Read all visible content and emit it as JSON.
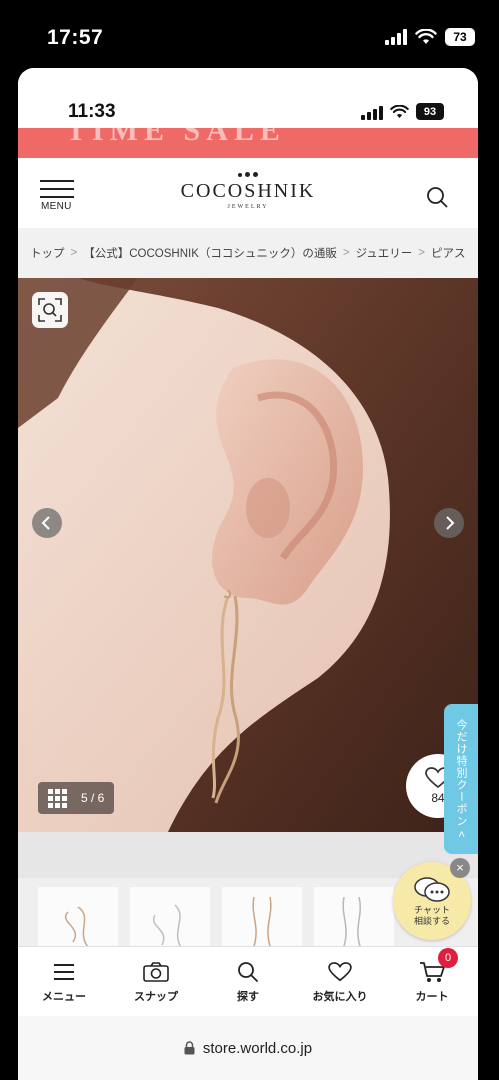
{
  "outer_status": {
    "time": "17:57",
    "battery": "73"
  },
  "inner_status": {
    "time": "11:33",
    "battery": "93"
  },
  "banner": {
    "text": "TIME SALE"
  },
  "header": {
    "menu_label": "MENU",
    "logo": "COCOSHNIK",
    "logo_sub": "JEWELRY"
  },
  "breadcrumb": [
    "トップ",
    "【公式】COCOSHNIK（ココシュニック）の通販",
    "ジュエリー",
    "ピアス"
  ],
  "gallery": {
    "page_indicator": "5 / 6",
    "favorite_count": "84"
  },
  "coupon_tab": "今だけ特別クーポン <",
  "chat": {
    "line1": "チャット",
    "line2": "相談する",
    "close": "×"
  },
  "bottom_nav": [
    {
      "label": "メニュー",
      "icon": "hamburger-icon"
    },
    {
      "label": "スナップ",
      "icon": "camera-icon"
    },
    {
      "label": "探す",
      "icon": "search-icon"
    },
    {
      "label": "お気に入り",
      "icon": "heart-icon"
    },
    {
      "label": "カート",
      "icon": "cart-icon",
      "badge": "0"
    }
  ],
  "url": "store.world.co.jp",
  "colors": {
    "sale_banner": "#ef6a66",
    "coupon": "#6fc8e4",
    "badge": "#e11d3f",
    "chat": "#f7e9a8"
  }
}
